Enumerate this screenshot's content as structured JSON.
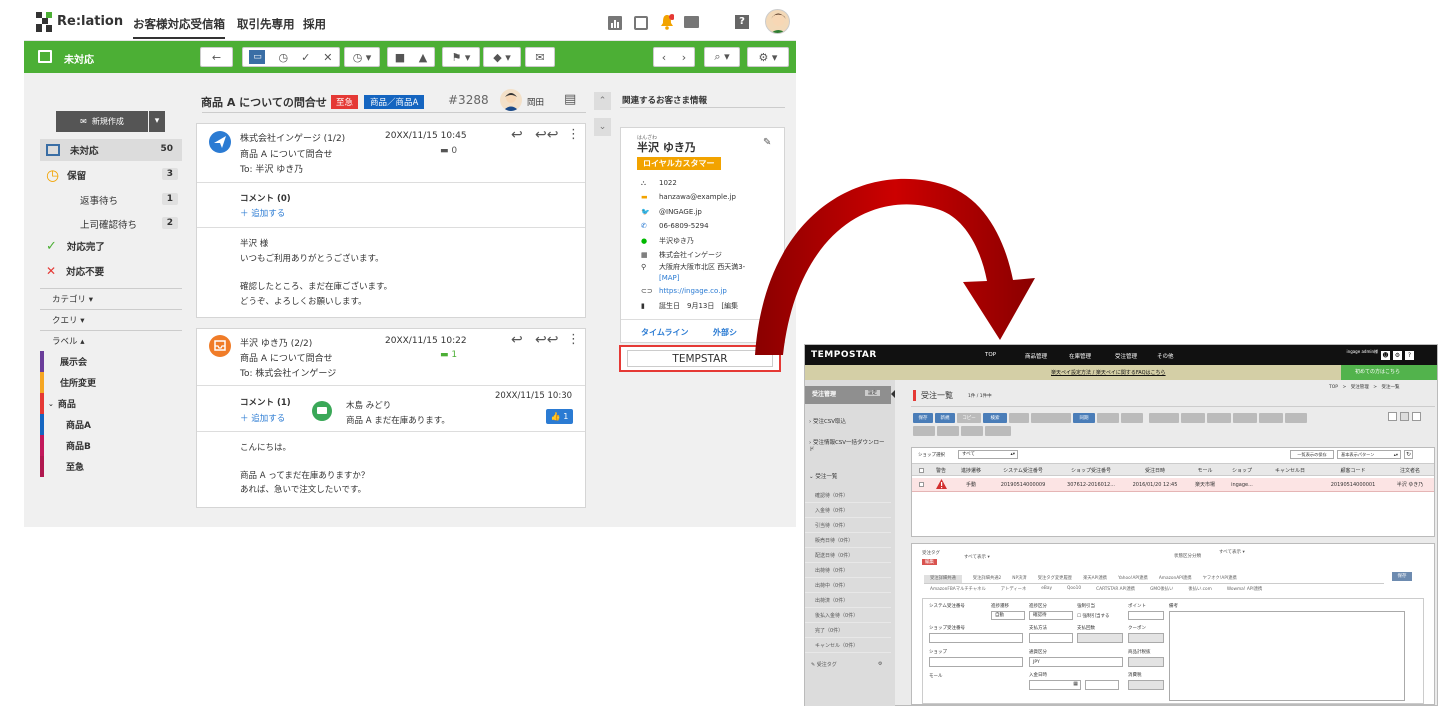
{
  "app": {
    "logo_text": "Re:lation",
    "tabs": [
      "お客様対応受信箱",
      "取引先専用",
      "採用"
    ]
  },
  "inbox_bar": {
    "title": "未対応"
  },
  "sidebar": {
    "new_button": "新規作成",
    "items": [
      {
        "label": "未対応",
        "count": "50"
      },
      {
        "label": "保留",
        "count": "3"
      },
      {
        "label": "返事待ち",
        "count": "1"
      },
      {
        "label": "上司確認待ち",
        "count": "2"
      },
      {
        "label": "対応完了",
        "count": ""
      },
      {
        "label": "対応不要",
        "count": ""
      }
    ],
    "sections": {
      "category": "カテゴリ",
      "query": "クエリ",
      "label": "ラベル"
    },
    "labels": [
      {
        "name": "展示会",
        "color": "#6a3d9a"
      },
      {
        "name": "住所変更",
        "color": "#f5a623"
      },
      {
        "name": "商品",
        "color": "#e53935"
      },
      {
        "name": "商品A",
        "color": "#1565c0"
      },
      {
        "name": "商品B",
        "color": "#c2185b"
      },
      {
        "name": "至急",
        "color": "#b0184f"
      }
    ]
  },
  "ticket": {
    "title": "商品 A についての問合せ",
    "tag_urgent": "至急",
    "tag_product": "商品／商品A",
    "number": "#3288",
    "assignee": "岡田"
  },
  "messages": [
    {
      "from": "株式会社インゲージ (1/2)",
      "date": "20XX/11/15 10:45",
      "subject": "商品 A について問合せ",
      "to": "To: 半沢 ゆき乃",
      "comment_count": "0",
      "comment_title": "コメント (0)",
      "add_comment": "＋ 追加する",
      "body": [
        "半沢 様",
        "いつもご利用ありがとうございます。",
        "",
        "確認したところ、まだ在庫ございます。",
        "どうぞ、よろしくお願いします。"
      ]
    },
    {
      "from": "半沢 ゆき乃 (2/2)",
      "date": "20XX/11/15 10:22",
      "subject": "商品 A について問合せ",
      "to": "To: 株式会社インゲージ",
      "comment_count": "1",
      "comment_title": "コメント (1)",
      "add_comment": "＋ 追加する",
      "commenter": "木島 みどり",
      "comment_date": "20XX/11/15 10:30",
      "comment_text": "商品 A まだ在庫あります。",
      "like_count": "1",
      "body": [
        "こんにちは。",
        "",
        "商品 A ってまだ在庫ありますか？",
        "あれば、急いで注文したいです。"
      ]
    }
  ],
  "customer": {
    "panel_title": "関連するお客さま情報",
    "furigana": "はんざわ",
    "name": "半沢 ゆき乃",
    "badge": "ロイヤルカスタマー",
    "fields": [
      "1022",
      "hanzawa@example.jp",
      "@INGAGE.jp",
      "06-6809-5294",
      "半沢ゆき乃",
      "株式会社インゲージ",
      "大阪府大阪市北区 西天満3-",
      "[MAP]",
      "https://ingage.co.jp",
      "誕生日　9月13日　[編集"
    ],
    "tabs": [
      "タイムライン",
      "外部シ"
    ]
  },
  "tempstar_box": "TEMPSTAR",
  "tempostar": {
    "logo": "TEMPOSTAR",
    "nav": [
      "TOP",
      "商品管理",
      "在庫管理",
      "受注管理",
      "その他"
    ],
    "user": "ingage admin様",
    "notice": "楽天ペイ設定方法 / 楽天ペイに関するFAQはこちら",
    "first_time": "初めての方はこちら",
    "side_title": "受注管理",
    "side_settings": "設定",
    "side_menu": [
      "受注CSV取込",
      "受注情報CSV一括ダウンロード",
      "受注一覧"
    ],
    "side_sub": [
      "確認待（0件）",
      "入金待（0件）",
      "引当待（0件）",
      "販売日待（0件）",
      "配送日待（0件）",
      "出荷待（0件）",
      "出荷中（0件）",
      "出荷済（0件）",
      "後払入金待（0件）",
      "完了（0件）",
      "キャンセル（0件）"
    ],
    "side_tag": "受注タグ",
    "page_title": "受注一覧",
    "page_count": "1件 / 1件中",
    "breadcrumb": "TOP　>　受注管理　>　受注一覧",
    "buttons": [
      "保存",
      "新規",
      "コピー",
      "検索",
      "同期"
    ],
    "shop_select": "ショップ選択",
    "shop_value": "すべて",
    "view_save": "一覧表示の保存",
    "pattern": "基本表示パターン",
    "columns": [
      "警告",
      "進捗遷移",
      "システム受注番号",
      "ショップ受注番号",
      "受注日時",
      "モール",
      "ショップ",
      "キャンセル日",
      "顧客コード",
      "注文者名"
    ],
    "row": [
      "",
      "手動",
      "20190514000009",
      "307612-2016012...",
      "2016/01/20 12:45",
      "楽天市場",
      "ingage...",
      "",
      "20190514000001",
      "半沢 ゆき乃"
    ],
    "tag_label": "受注タグ",
    "tag_value": "すべて表示",
    "status_label": "状態区分分類",
    "status_value": "すべて表示",
    "edit": "編集",
    "tabs1": [
      "受注詳細共通",
      "受注詳細共通2",
      "NP決済",
      "受注タグ変更履歴",
      "楽天API連携",
      "Yahoo!API連携",
      "AmazonAPI連携",
      "ヤフオク!API連携"
    ],
    "tabs2": [
      "AmazonFBAマルチチャネル",
      "アトディーネ",
      "eBay",
      "Qoo10",
      "CARTSTAR API連携",
      "GMO後払い",
      "後払い.com",
      "Wowma! API連携"
    ],
    "save": "保存",
    "form_labels": [
      "システム受注番号",
      "進捗遷移",
      "進捗区分",
      "強制引当",
      "ポイント",
      "備考",
      "ショップ受注番号",
      "支払方法",
      "支払回数",
      "クーポン",
      "ショップ",
      "通貨区分",
      "商品計税抜",
      "モール",
      "入金日時",
      "消費税"
    ],
    "form_values": [
      "自動",
      "確認待",
      "強制引当する",
      "JPY"
    ]
  }
}
